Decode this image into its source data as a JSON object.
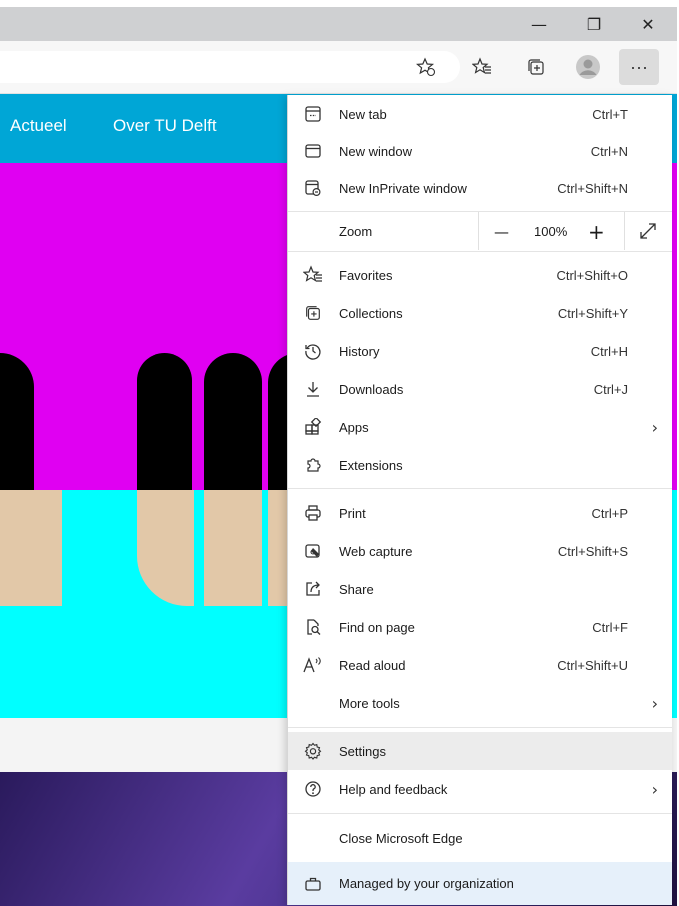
{
  "window": {
    "minimize_glyph": "—",
    "restore_glyph": "❐",
    "close_glyph": "✕"
  },
  "toolbar": {
    "icons": [
      "add-favorite-icon",
      "favorites-icon",
      "collections-icon",
      "profile-avatar",
      "more-icon"
    ],
    "more_glyph": "···"
  },
  "site": {
    "nav": [
      "Actueel",
      "Over TU Delft"
    ],
    "colors": {
      "nav": "#00a6d6",
      "magenta": "#e000f2",
      "cyan": "#00ffff",
      "tan": "#e2c8a8"
    }
  },
  "menu": {
    "items": [
      {
        "label": "New tab",
        "shortcut": "Ctrl+T",
        "icon": "new-tab-icon"
      },
      {
        "label": "New window",
        "shortcut": "Ctrl+N",
        "icon": "new-window-icon"
      },
      {
        "label": "New InPrivate window",
        "shortcut": "Ctrl+Shift+N",
        "icon": "inprivate-icon"
      },
      {
        "label": "Favorites",
        "shortcut": "Ctrl+Shift+O",
        "icon": "favorites-icon"
      },
      {
        "label": "Collections",
        "shortcut": "Ctrl+Shift+Y",
        "icon": "collections-icon"
      },
      {
        "label": "History",
        "shortcut": "Ctrl+H",
        "icon": "history-icon"
      },
      {
        "label": "Downloads",
        "shortcut": "Ctrl+J",
        "icon": "download-icon"
      },
      {
        "label": "Apps",
        "shortcut": "",
        "icon": "apps-icon"
      },
      {
        "label": "Extensions",
        "shortcut": "",
        "icon": "extensions-icon"
      },
      {
        "label": "Print",
        "shortcut": "Ctrl+P",
        "icon": "print-icon"
      },
      {
        "label": "Web capture",
        "shortcut": "Ctrl+Shift+S",
        "icon": "web-capture-icon"
      },
      {
        "label": "Share",
        "shortcut": "",
        "icon": "share-icon"
      },
      {
        "label": "Find on page",
        "shortcut": "Ctrl+F",
        "icon": "find-icon"
      },
      {
        "label": "Read aloud",
        "shortcut": "Ctrl+Shift+U",
        "icon": "read-aloud-icon"
      },
      {
        "label": "More tools",
        "shortcut": "",
        "icon": ""
      },
      {
        "label": "Settings",
        "shortcut": "",
        "icon": "settings-icon"
      },
      {
        "label": "Help and feedback",
        "shortcut": "",
        "icon": "help-icon"
      },
      {
        "label": "Close Microsoft Edge",
        "shortcut": "",
        "icon": ""
      },
      {
        "label": "Managed by your organization",
        "shortcut": "",
        "icon": "briefcase-icon"
      }
    ],
    "zoom": {
      "label": "Zoom",
      "value": "100%",
      "minus": "—",
      "plus": "+"
    },
    "chevron": "›"
  }
}
